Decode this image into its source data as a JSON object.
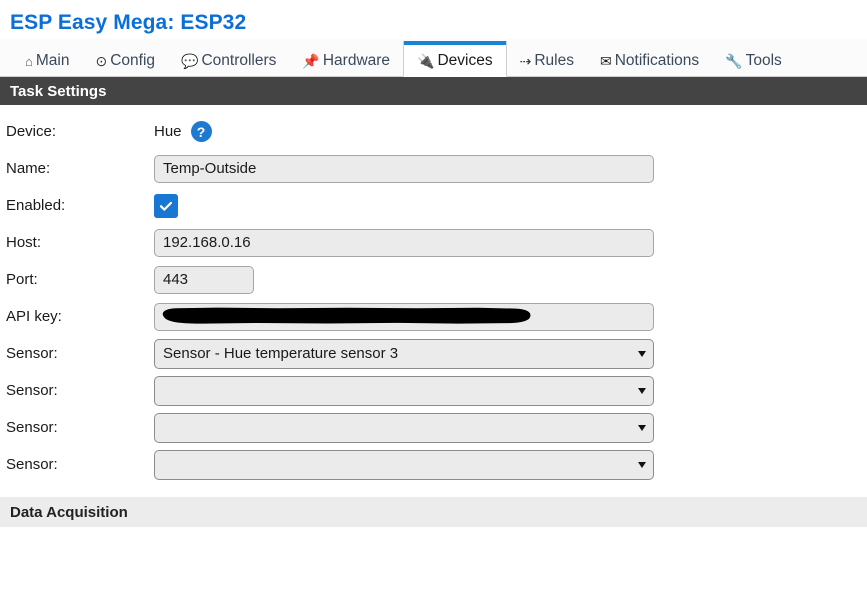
{
  "header": {
    "title": "ESP Easy Mega: ESP32"
  },
  "nav": {
    "tabs": [
      {
        "label": "Main",
        "icon": "house-icon",
        "glyph": "⌂",
        "active": false
      },
      {
        "label": "Config",
        "icon": "gear-icon",
        "glyph": "⊙",
        "active": false
      },
      {
        "label": "Controllers",
        "icon": "speech-bubble-icon",
        "glyph": "💬",
        "active": false
      },
      {
        "label": "Hardware",
        "icon": "pushpin-icon",
        "glyph": "📌",
        "active": false
      },
      {
        "label": "Devices",
        "icon": "plug-icon",
        "glyph": "🔌",
        "active": true
      },
      {
        "label": "Rules",
        "icon": "arrow-icon",
        "glyph": "⇢",
        "active": false
      },
      {
        "label": "Notifications",
        "icon": "envelope-icon",
        "glyph": "✉",
        "active": false
      },
      {
        "label": "Tools",
        "icon": "wrench-icon",
        "glyph": "🔧",
        "active": false
      }
    ]
  },
  "sections": {
    "task_settings_title": "Task Settings",
    "data_acquisition_title": "Data Acquisition"
  },
  "form": {
    "device_label": "Device:",
    "device_value": "Hue",
    "help_glyph": "?",
    "name_label": "Name:",
    "name_value": "Temp-Outside",
    "enabled_label": "Enabled:",
    "enabled_checked": true,
    "host_label": "Host:",
    "host_value": "192.168.0.16",
    "port_label": "Port:",
    "port_value": "443",
    "apikey_label": "API key:",
    "apikey_value": "",
    "apikey_redacted": true,
    "sensors": [
      {
        "label": "Sensor:",
        "value": "Sensor - Hue temperature sensor 3"
      },
      {
        "label": "Sensor:",
        "value": ""
      },
      {
        "label": "Sensor:",
        "value": ""
      },
      {
        "label": "Sensor:",
        "value": ""
      }
    ]
  },
  "colors": {
    "title_blue": "#0b6fd8",
    "accent_blue": "#1884d8",
    "checkbox_blue": "#1877d2",
    "dark_bar": "#444444",
    "light_bar": "#ececec",
    "field_bg": "#ebebeb"
  }
}
